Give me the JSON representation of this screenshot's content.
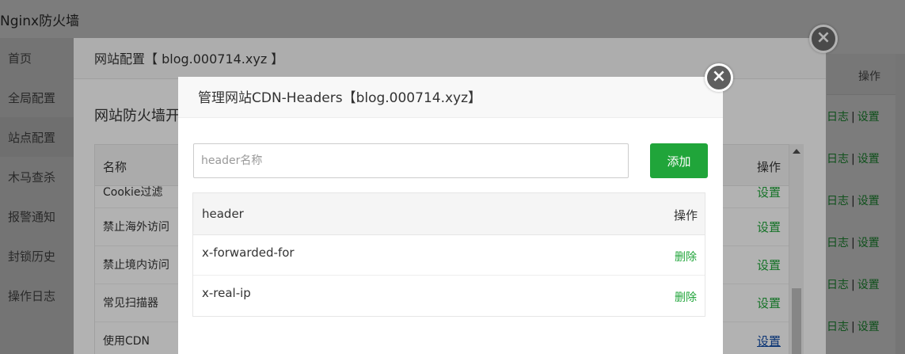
{
  "app": {
    "title": "Nginx防火墙"
  },
  "sidebar": {
    "items": [
      {
        "label": "首页"
      },
      {
        "label": "全局配置"
      },
      {
        "label": "站点配置"
      },
      {
        "label": "木马查杀"
      },
      {
        "label": "报警通知"
      },
      {
        "label": "封锁历史"
      },
      {
        "label": "操作日志"
      }
    ]
  },
  "background_table": {
    "header": "操作",
    "rows": [
      {
        "log": "日志",
        "sep": "|",
        "settings": "设置"
      },
      {
        "log": "日志",
        "sep": "|",
        "settings": "设置"
      },
      {
        "log": "日志",
        "sep": "|",
        "settings": "设置"
      },
      {
        "log": "日志",
        "sep": "|",
        "settings": "设置"
      },
      {
        "log": "日志",
        "sep": "|",
        "settings": "设置"
      },
      {
        "log": "日志",
        "sep": "|",
        "settings": "设置"
      }
    ]
  },
  "site_dialog": {
    "title": "网站配置【 blog.000714.xyz 】",
    "section_title": "网站防火墙开",
    "table": {
      "col_name": "名称",
      "col_action": "操作",
      "rows": [
        {
          "name": "Cookie过滤",
          "action": "设置"
        },
        {
          "name": "禁止海外访问",
          "action": "设置"
        },
        {
          "name": "禁止境内访问",
          "action": "设置"
        },
        {
          "name": "常见扫描器",
          "action": "设置"
        },
        {
          "name": "使用CDN",
          "action": "设置"
        }
      ]
    }
  },
  "cdn_dialog": {
    "title": "管理网站CDN-Headers【blog.000714.xyz】",
    "input_placeholder": "header名称",
    "add_button": "添加",
    "table": {
      "col_header": "header",
      "col_action": "操作",
      "rows": [
        {
          "header": "x-forwarded-for",
          "action": "删除"
        },
        {
          "header": "x-real-ip",
          "action": "删除"
        }
      ]
    }
  },
  "colors": {
    "accent": "#20a53a",
    "link": "#0e4aa6"
  }
}
